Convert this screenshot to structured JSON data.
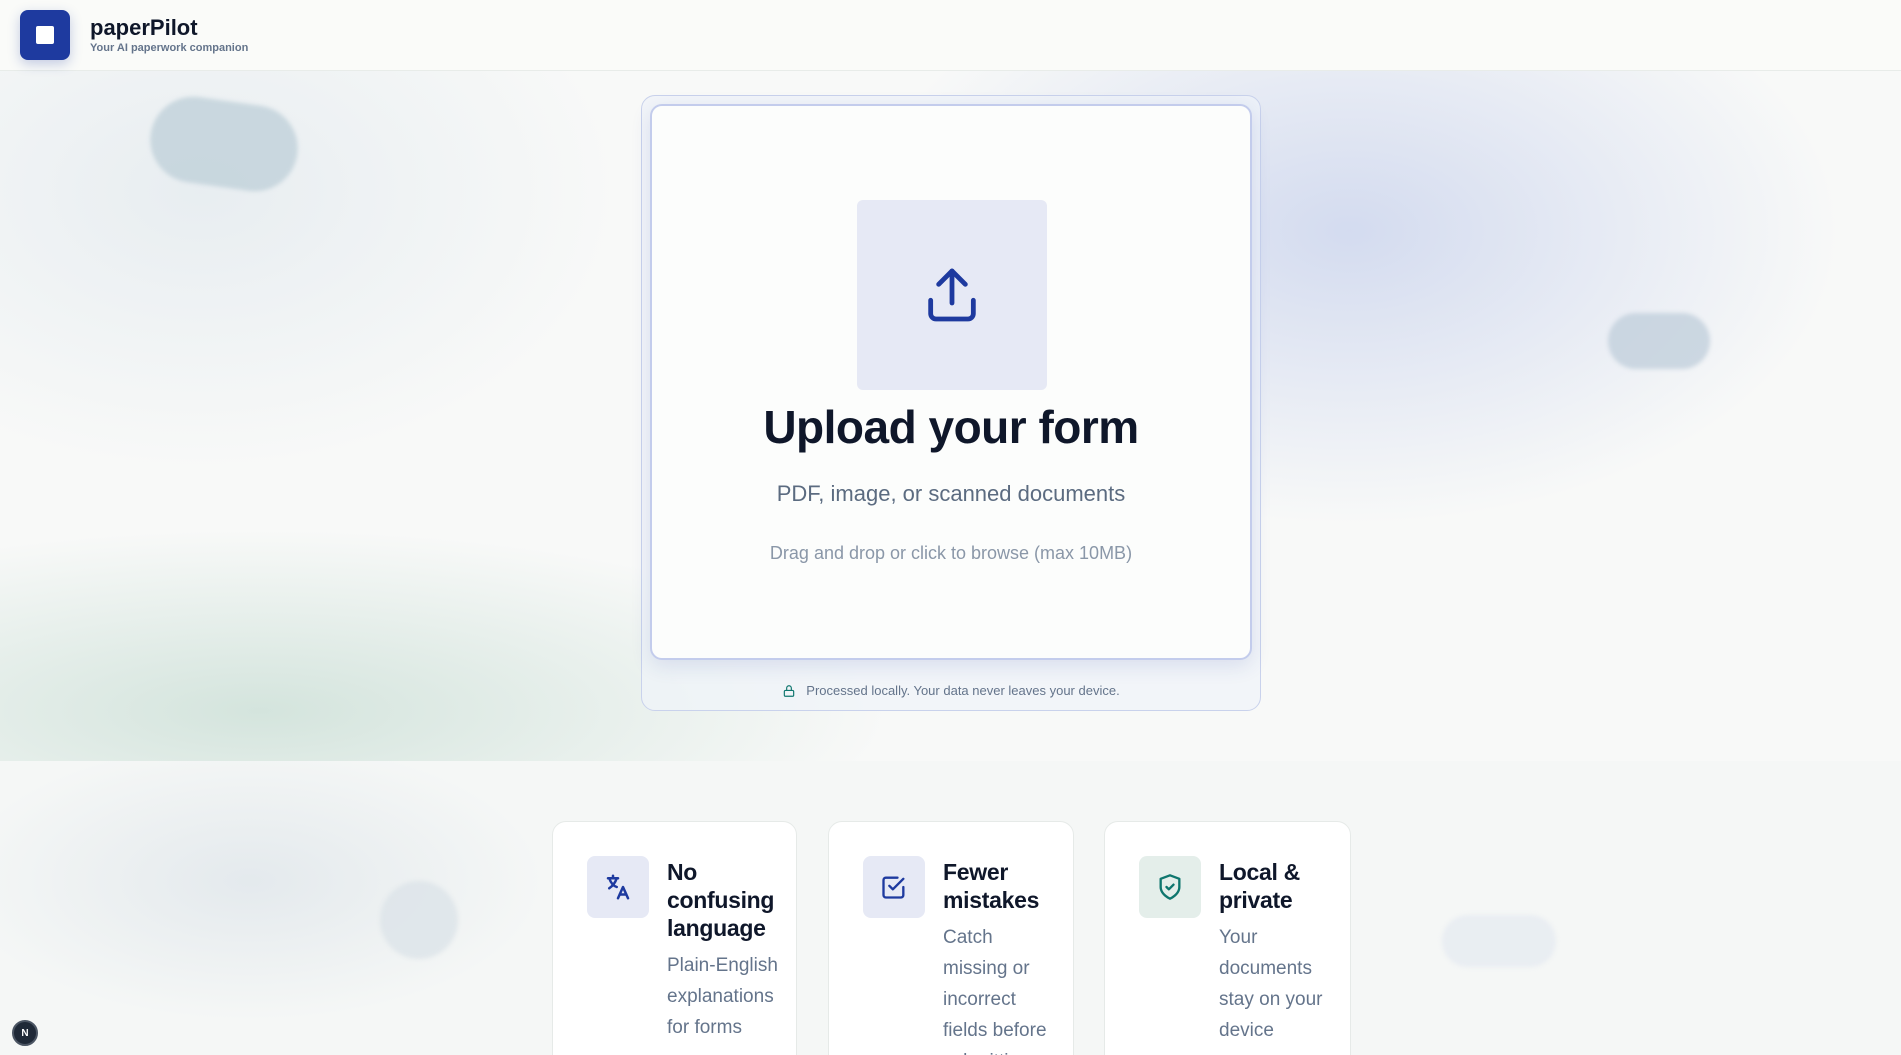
{
  "header": {
    "brand_name": "paperPilot",
    "tagline": "Your AI paperwork companion",
    "logo_icon": "square-logo-icon"
  },
  "upload": {
    "icon": "upload-icon",
    "title": "Upload your form",
    "subtitle": "PDF, image, or scanned documents",
    "hint": "Drag and drop or click to browse (max 10MB)",
    "privacy_icon": "lock-icon",
    "privacy_text": "Processed locally. Your data never leaves your device."
  },
  "features": [
    {
      "icon": "translate-icon",
      "title": "No confusing language",
      "description": "Plain-English explanations for forms"
    },
    {
      "icon": "checkbox-icon",
      "title": "Fewer mistakes",
      "description": "Catch missing or incorrect fields before submitting"
    },
    {
      "icon": "shield-check-icon",
      "title": "Local & private",
      "description": "Your documents stay on your device"
    }
  ],
  "badge": {
    "label": "N"
  },
  "colors": {
    "brand": "#1e3a9f",
    "accent_green": "#0f766e",
    "text_primary": "#0f172a",
    "text_muted": "#64748b"
  }
}
